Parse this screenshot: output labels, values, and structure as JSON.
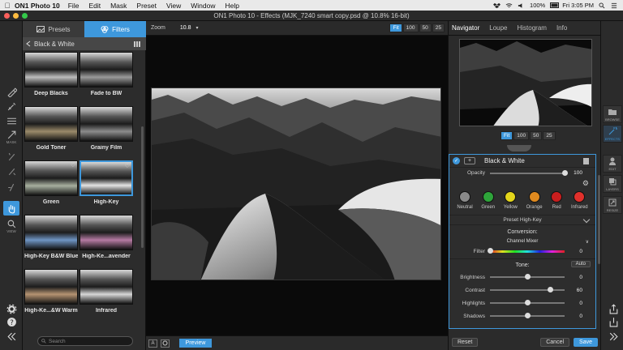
{
  "menubar": {
    "app": "ON1 Photo 10",
    "items": [
      "File",
      "Edit",
      "Mask",
      "Preset",
      "View",
      "Window",
      "Help"
    ],
    "battery": "100%",
    "clock": "Fri 3:05 PM"
  },
  "titlebar": {
    "title": "ON1 Photo 10 - Effects (MJK_7240 smart copy.psd @ 10.8% 16-bit)"
  },
  "leftrail": {
    "mask_label": "MASK",
    "view_label": "VIEW"
  },
  "browser": {
    "tabs": [
      {
        "label": "Presets"
      },
      {
        "label": "Filters"
      }
    ],
    "breadcrumb": "Black & White",
    "thumbnails": [
      {
        "label": "Deep Blacks",
        "tone": "#bdbdbd"
      },
      {
        "label": "Fade to BW",
        "tone": "#9a9a9a"
      },
      {
        "label": "Gold Toner",
        "tone": "#9b8b6a"
      },
      {
        "label": "Grainy Film",
        "tone": "#8c8c8c"
      },
      {
        "label": "Green",
        "tone": "#a7b09f"
      },
      {
        "label": "High-Key",
        "tone": "#e4e4e4"
      },
      {
        "label": "High-Key B&W Blue",
        "tone": "#6f95c4"
      },
      {
        "label": "High-Ke...avender",
        "tone": "#b57aa3"
      },
      {
        "label": "High-Ke...&W Warm",
        "tone": "#b59372"
      },
      {
        "label": "Infrared",
        "tone": "#d7d7d7"
      }
    ],
    "search_placeholder": "Search"
  },
  "viewbar": {
    "zoom_label": "Zoom",
    "zoom_value": "10.8",
    "buttons": [
      "Fit",
      "100",
      "50",
      "25"
    ]
  },
  "bottombar": {
    "a_label": "A",
    "preview": "Preview"
  },
  "right": {
    "tabs": [
      "Navigator",
      "Loupe",
      "Histogram",
      "Info"
    ],
    "nav_zoom": [
      "Fit",
      "100",
      "50",
      "25"
    ],
    "filter": {
      "title": "Black & White",
      "opacity_label": "Opacity",
      "opacity_value": "100",
      "swatches": [
        {
          "label": "Neutral",
          "color": "#8a8a8a"
        },
        {
          "label": "Green",
          "color": "#2ea43a"
        },
        {
          "label": "Yellow",
          "color": "#e3d51b"
        },
        {
          "label": "Orange",
          "color": "#e08a1f"
        },
        {
          "label": "Red",
          "color": "#c81e1e"
        },
        {
          "label": "Infrared",
          "color": "#e0302b"
        }
      ],
      "preset": "Preset  High-Key",
      "conversion_label": "Conversion:",
      "conversion_mode": "Channel Mixer",
      "filter_label": "Filter",
      "filter_value": "0",
      "tone_label": "Tone:",
      "auto_label": "Auto",
      "sliders": [
        {
          "label": "Brightness",
          "value": "0",
          "level": 0.5
        },
        {
          "label": "Contrast",
          "value": "60",
          "level": 0.8
        },
        {
          "label": "Highlights",
          "value": "0",
          "level": 0.5
        },
        {
          "label": "Shadows",
          "value": "0",
          "level": 0.5
        }
      ]
    },
    "reset": "Reset",
    "cancel": "Cancel",
    "save": "Save"
  },
  "rightrail": {
    "items": [
      "BROWSE",
      "EFFECTS",
      "EDIT",
      "LAYERS",
      "RESIZE"
    ]
  }
}
